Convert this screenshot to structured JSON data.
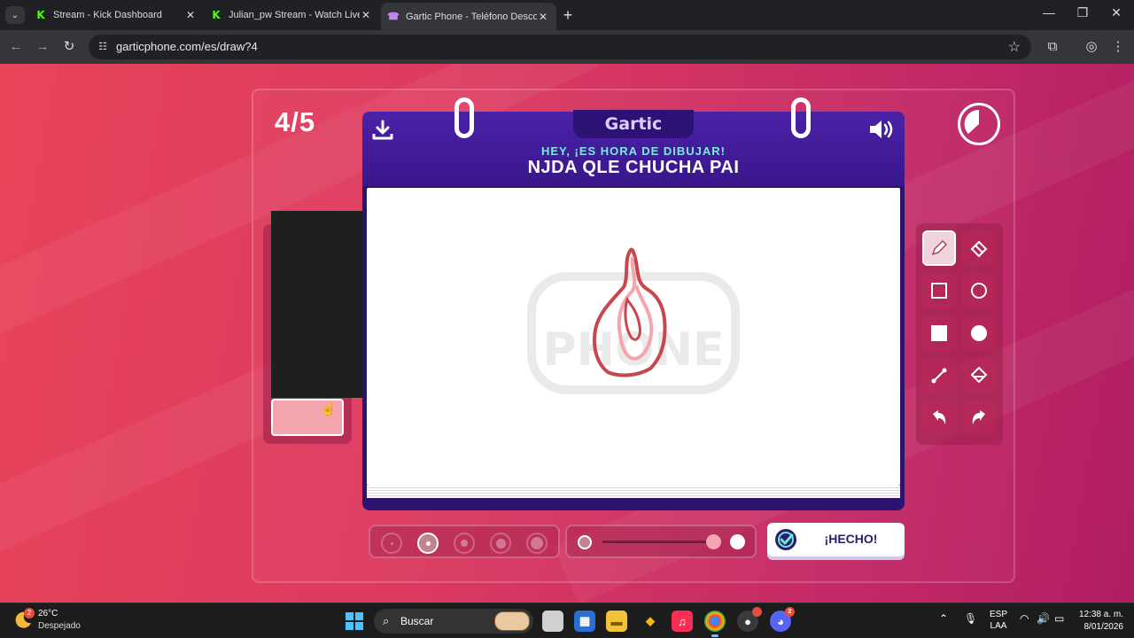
{
  "browser": {
    "tabs": [
      {
        "title": "Stream - Kick Dashboard",
        "favicon": "kick-icon",
        "active": false
      },
      {
        "title": "Julian_pw Stream - Watch Live o",
        "favicon": "kick-icon",
        "active": false
      },
      {
        "title": "Gartic Phone - Teléfono Descon",
        "favicon": "gartic-phone-icon",
        "active": true
      }
    ],
    "new_tab": "+",
    "url": "garticphone.com/es/draw?4"
  },
  "game": {
    "round": "4/5",
    "logo": "Gartic",
    "subtitle": "HEY, ¡ES HORA DE DIBUJAR!",
    "prompt": "NJDA QLE CHUCHA PAI",
    "done_label": "¡HECHO!",
    "selected_color": "#f4a5ad",
    "selected_tool": "pencil",
    "selected_brush_size": 2,
    "opacity": 1.0,
    "timer_elapsed_fraction": 0.4
  },
  "taskbar": {
    "weather": {
      "temp": "26°C",
      "desc": "Despejado",
      "badge": "2"
    },
    "search_label": "Buscar",
    "lang": [
      "ESP",
      "LAA"
    ],
    "time": "12:38 a. m.",
    "date": "8/01/2026",
    "discord_badge": "2"
  }
}
